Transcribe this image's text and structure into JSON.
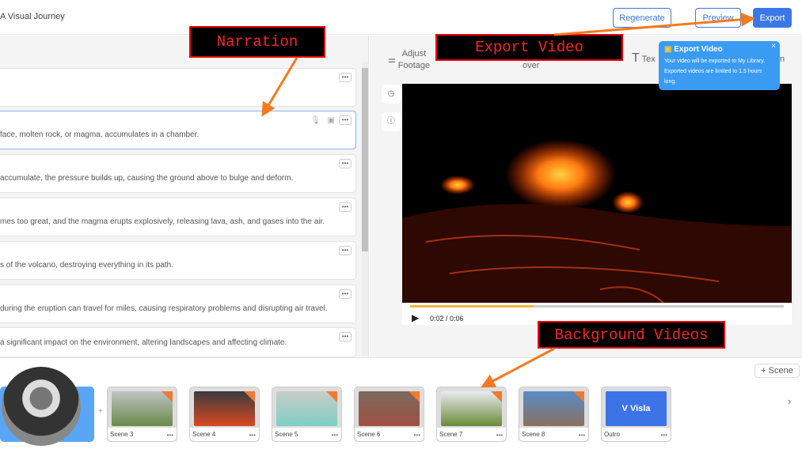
{
  "header": {
    "title": "A Visual Journey",
    "regenerate": "Regenerate",
    "preview": "Preview",
    "export": "Export"
  },
  "scenes_text": [
    "",
    "face, molten rock, or magma, accumulates in a chamber.",
    "accumulate, the pressure builds up, causing the ground above to bulge and deform.",
    "mes too great, and the magma erupts explosively, releasing lava, ash, and gases into the air.",
    "s of the volcano, destroying everything in its path.",
    "during the eruption can travel for miles, causing respiratory problems and disrupting air travel.",
    "a significant impact on the environment, altering landscapes and affecting climate."
  ],
  "more_label": "•••",
  "toolbar": {
    "adjust_footage": "Adjust Footage",
    "voice_over": "over",
    "text": "Tex",
    "partial": "n"
  },
  "tooltip": {
    "title": "Export Video",
    "body": "Your video will be exported to My Library. Exported videos are limited to 1.5 hours long.",
    "close": "×"
  },
  "player": {
    "time": "0:02 / 0:06",
    "progress": 0.33
  },
  "bottom": {
    "add_scene": "Scene",
    "cards": [
      {
        "label": "Scene 3",
        "colors": [
          "#bfc3c6",
          "#6a8a4a"
        ]
      },
      {
        "label": "Scene 4",
        "colors": [
          "#3a3a40",
          "#d84a20"
        ]
      },
      {
        "label": "Scene 5",
        "colors": [
          "#c8ccc8",
          "#7ecfc5"
        ]
      },
      {
        "label": "Scene 6",
        "colors": [
          "#7a6a60",
          "#a05040"
        ]
      },
      {
        "label": "Scene 7",
        "colors": [
          "#e8ecee",
          "#6b8a3a"
        ]
      },
      {
        "label": "Scene 8",
        "colors": [
          "#5a8cc8",
          "#8a7060"
        ]
      },
      {
        "label": "Outro",
        "colors": [
          "#3c74e8",
          "#3c74e8"
        ]
      }
    ],
    "outro_logo": "V Visla"
  },
  "annotations": {
    "narration": "Narration",
    "export_video": "Export Video",
    "background_videos": "Background Videos"
  }
}
